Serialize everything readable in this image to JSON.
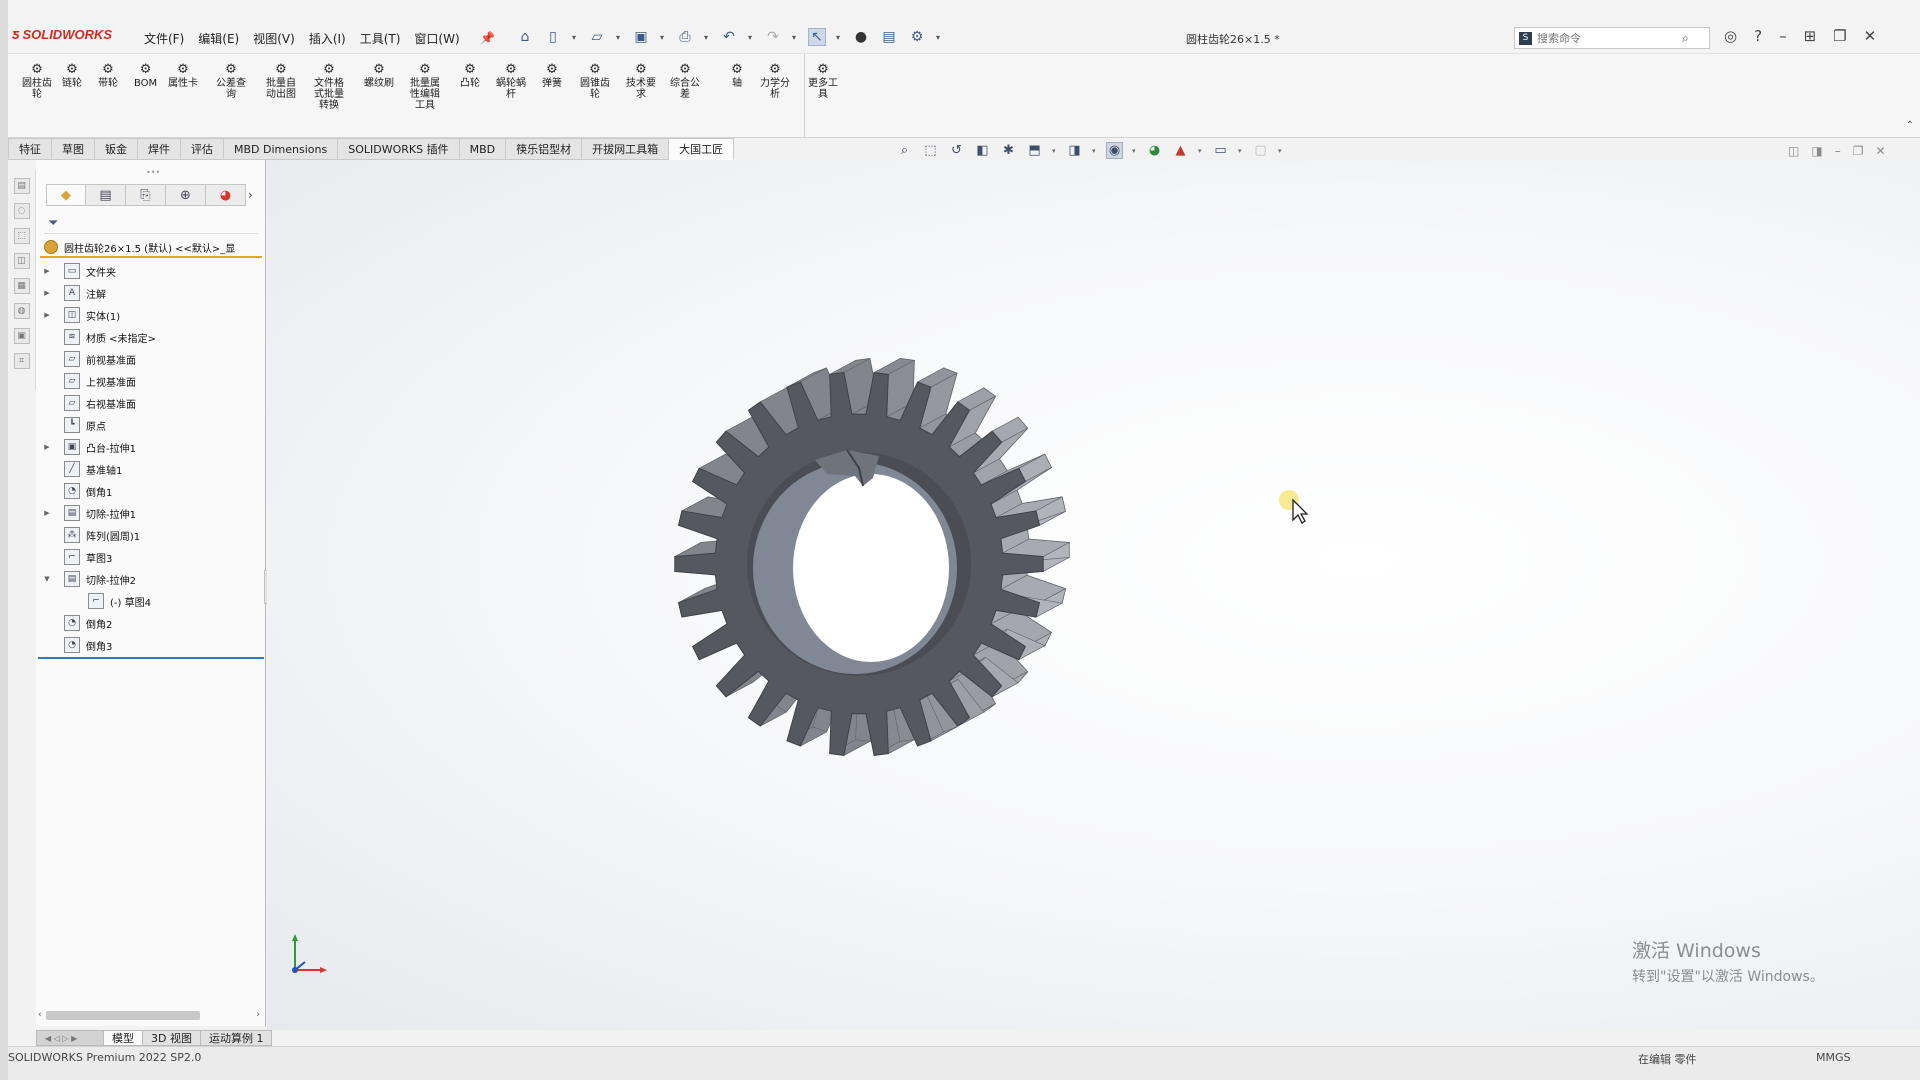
{
  "app": {
    "brand": "SOLIDWORKS",
    "document_title": "圆柱齿轮26×1.5 *"
  },
  "menu": [
    "文件(F)",
    "编辑(E)",
    "视图(V)",
    "插入(I)",
    "工具(T)",
    "窗口(W)"
  ],
  "search": {
    "placeholder": "搜索命令"
  },
  "ribbon": {
    "commands": [
      {
        "label": "圆柱齿\n轮",
        "icon": "gear-icon"
      },
      {
        "label": "链轮",
        "icon": "sprocket-icon"
      },
      {
        "label": "带轮",
        "icon": "pulley-icon"
      },
      {
        "label": "BOM",
        "icon": "bom-table-icon"
      },
      {
        "label": "属性卡",
        "icon": "property-card-icon"
      },
      {
        "label": "公差查\n询",
        "icon": "tolerance-icon"
      },
      {
        "label": "批量自\n动出图",
        "icon": "batch-drawing-icon"
      },
      {
        "label": "文件格\n式批量\n转换",
        "icon": "file-convert-icon"
      },
      {
        "label": "螺纹刷",
        "icon": "thread-brush-icon"
      },
      {
        "label": "批量属\n性编辑\n工具",
        "icon": "batch-property-icon"
      },
      {
        "label": "凸轮",
        "icon": "cam-icon"
      },
      {
        "label": "蜗轮蜗\n杆",
        "icon": "worm-gear-icon"
      },
      {
        "label": "弹簧",
        "icon": "spring-icon"
      },
      {
        "label": "圆锥齿\n轮",
        "icon": "bevel-gear-icon"
      },
      {
        "label": "技术要\n求",
        "icon": "tech-req-icon"
      },
      {
        "label": "综合公\n差",
        "icon": "composite-tol-icon"
      },
      {
        "label": "轴",
        "icon": "shaft-icon"
      },
      {
        "label": "力学分\n析",
        "icon": "mechanics-icon"
      },
      {
        "label": "更多工\n具",
        "icon": "more-tools-icon"
      }
    ]
  },
  "tabs": [
    "特征",
    "草图",
    "钣金",
    "焊件",
    "评估",
    "MBD Dimensions",
    "SOLIDWORKS 插件",
    "MBD",
    "筷乐铝型材",
    "开拔网工具箱",
    "大国工匠"
  ],
  "feature_tree": {
    "root": "圆柱齿轮26×1.5 (默认) <<默认>_显",
    "items": [
      {
        "label": "文件夹",
        "expandable": true,
        "icon": "folder-icon"
      },
      {
        "label": "注解",
        "expandable": true,
        "icon": "annotation-icon"
      },
      {
        "label": "实体(1)",
        "expandable": true,
        "icon": "solid-body-icon"
      },
      {
        "label": "材质 <未指定>",
        "expandable": false,
        "icon": "material-icon"
      },
      {
        "label": "前视基准面",
        "expandable": false,
        "icon": "plane-icon"
      },
      {
        "label": "上视基准面",
        "expandable": false,
        "icon": "plane-icon"
      },
      {
        "label": "右视基准面",
        "expandable": false,
        "icon": "plane-icon"
      },
      {
        "label": "原点",
        "expandable": false,
        "icon": "origin-icon"
      },
      {
        "label": "凸台-拉伸1",
        "expandable": true,
        "icon": "boss-extrude-icon"
      },
      {
        "label": "基准轴1",
        "expandable": false,
        "icon": "axis-icon"
      },
      {
        "label": "倒角1",
        "expandable": false,
        "icon": "chamfer-icon"
      },
      {
        "label": "切除-拉伸1",
        "expandable": true,
        "icon": "cut-extrude-icon"
      },
      {
        "label": "阵列(圆周)1",
        "expandable": false,
        "icon": "circular-pattern-icon"
      },
      {
        "label": "草图3",
        "expandable": false,
        "icon": "sketch-icon"
      },
      {
        "label": "切除-拉伸2",
        "expandable": "open",
        "icon": "cut-extrude-icon"
      },
      {
        "label": "(-) 草图4",
        "expandable": false,
        "icon": "sketch-icon",
        "child": true
      },
      {
        "label": "倒角2",
        "expandable": false,
        "icon": "chamfer-icon"
      },
      {
        "label": "倒角3",
        "expandable": false,
        "icon": "chamfer-icon"
      }
    ]
  },
  "model": {
    "teeth": 26,
    "color": "#55595f"
  },
  "bottom_tabs": [
    "模型",
    "3D 视图",
    "运动算例 1"
  ],
  "status": {
    "left": "SOLIDWORKS Premium 2022 SP2.0",
    "mid": "在编辑 零件",
    "right": "MMGS"
  },
  "activation": {
    "line1": "激活 Windows",
    "line2": "转到\"设置\"以激活 Windows。"
  }
}
